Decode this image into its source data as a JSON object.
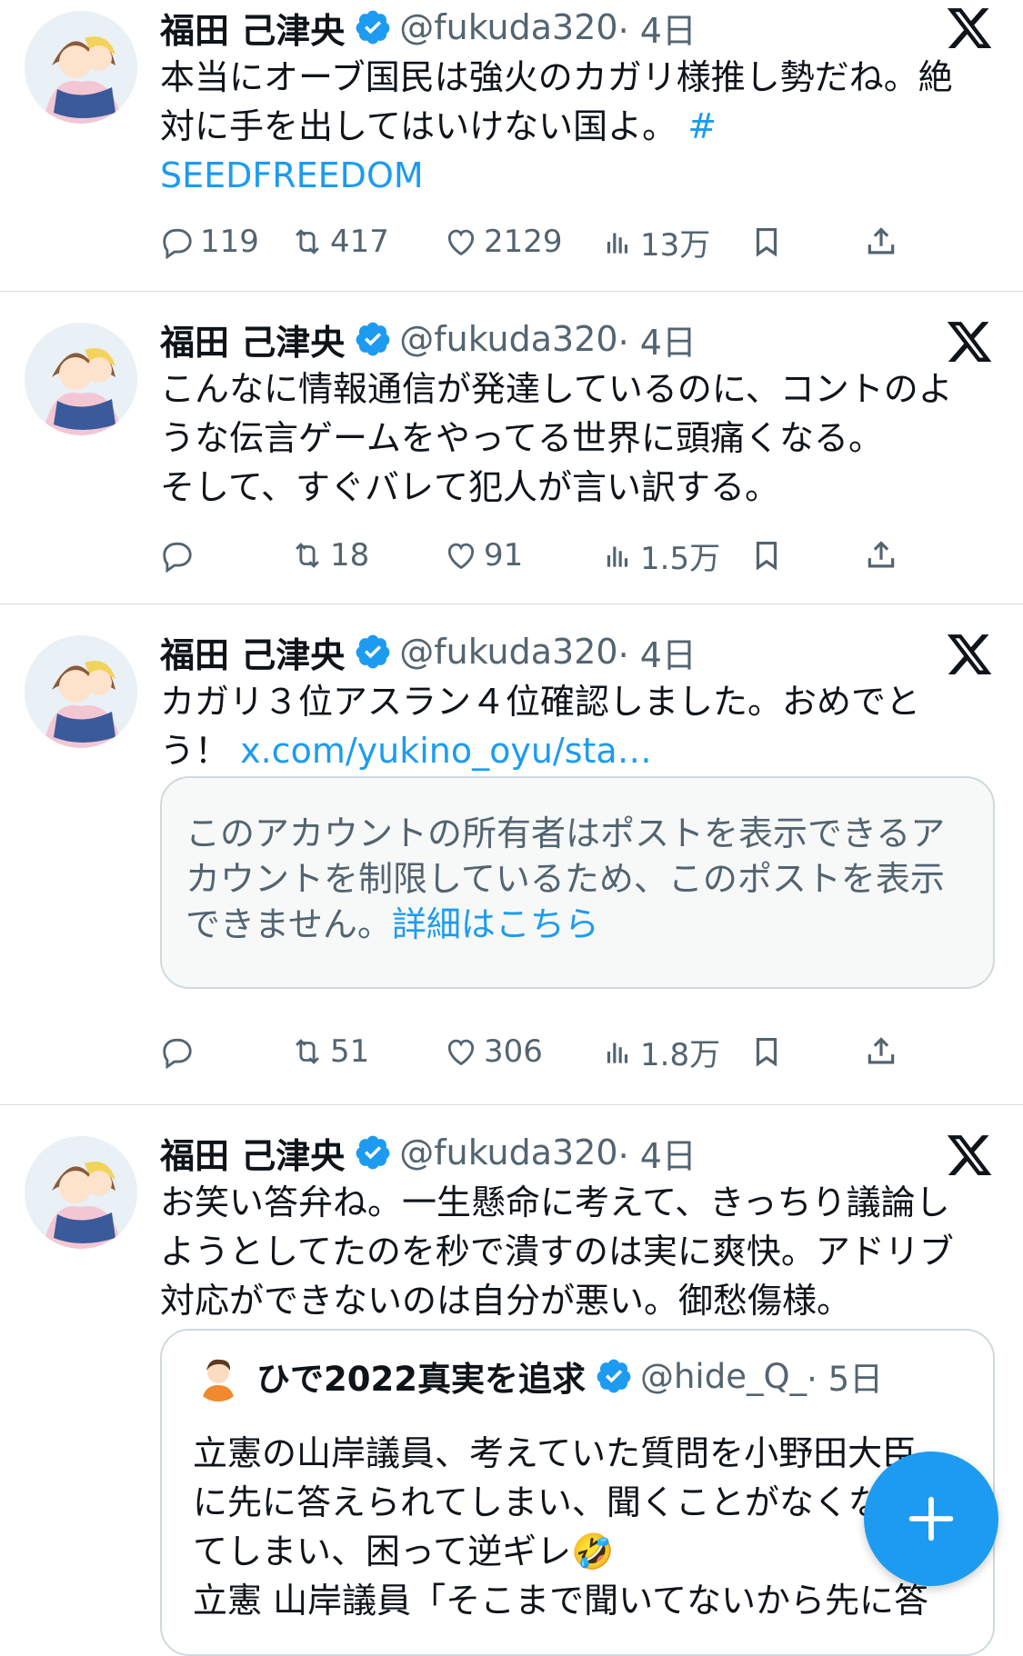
{
  "posts": [
    {
      "author": "福田 己津央",
      "handle": "@fukuda320",
      "time": "· 4日",
      "text": "本当にオーブ国民は強火のカガリ様推し勢だね。絶\n対に手を出してはいけない国よ。",
      "link": "#\nSEEDFREEDOM",
      "replies": "119",
      "reposts": "417",
      "likes": "2129",
      "views": "13万"
    },
    {
      "author": "福田 己津央",
      "handle": "@fukuda320",
      "time": "· 4日",
      "text": "こんなに情報通信が発達しているのに、コントのよ\nうな伝言ゲームをやってる世界に頭痛くなる。\nそして、すぐバレて犯人が言い訳する。",
      "replies": "",
      "reposts": "18",
      "likes": "91",
      "views": "1.5万"
    },
    {
      "author": "福田 己津央",
      "handle": "@fukuda320",
      "time": "· 4日",
      "text": "カガリ３位アスラン４位確認しました。おめでと\nう！",
      "link": "x.com/yukino_oyu/sta…",
      "notice_text": "このアカウントの所有者はポストを表示できるア\nカウントを制限しているため、このポストを表示\nできません。",
      "notice_link": "詳細はこちら",
      "replies": "",
      "reposts": "51",
      "likes": "306",
      "views": "1.8万"
    },
    {
      "author": "福田 己津央",
      "handle": "@fukuda320",
      "time": "· 4日",
      "text": "お笑い答弁ね。一生懸命に考えて、きっちり議論し\nようとしてたのを秒で潰すのは実に爽快。アドリブ\n対応ができないのは自分が悪い。御愁傷様。",
      "quote": {
        "author": "ひで2022真実を追求",
        "handle": "@hide_Q_",
        "time": "· 5日",
        "text": "立憲の山岸議員、考えていた質問を小野田大臣\nに先に答えられてしまい、聞くことがなくなっ\nてしまい、困って逆ギレ🤣\n立憲 山岸議員「そこまで聞いてないから先に答"
      }
    }
  ],
  "colors": {
    "accent": "#1d9bf0",
    "text": "#0f1419",
    "secondary": "#536471"
  },
  "icons": [
    "reply-icon",
    "repost-icon",
    "like-icon",
    "views-icon",
    "bookmark-icon",
    "share-icon",
    "x-logo-icon",
    "verified-badge-icon",
    "compose-plus-icon"
  ]
}
